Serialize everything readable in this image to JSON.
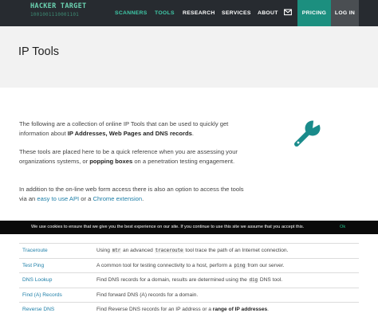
{
  "header": {
    "logo_text": "HACKER TARGET",
    "logo_sub": "1001001110001101",
    "nav": [
      "SCANNERS",
      "TOOLS",
      "RESEARCH",
      "SERVICES",
      "ABOUT"
    ],
    "mail_icon": "envelope-icon",
    "pricing_label": "PRICING",
    "login_label": "LOG IN",
    "colors": {
      "bar": "#272b30",
      "accent": "#3fc9a8",
      "pricing_bg": "#1c8f7f",
      "login_bg": "#4a4e52"
    }
  },
  "hero": {
    "title": "IP Tools"
  },
  "intro": {
    "p1_before": "The following are a collection of online IP Tools that can be used to quickly get information about ",
    "p1_bold": "IP Addresses, Web Pages and DNS records",
    "p1_after": ".",
    "p2_before": "These tools are placed here to be a quick reference when you are assessing your organizations systems, or ",
    "p2_bold": "popping boxes",
    "p2_after": " on a penetration testing engagement.",
    "p3_before": "In addition to the on-line web form access there is also an option to access the tools via an ",
    "p3_link1": "easy to use API",
    "p3_mid": " or a ",
    "p3_link2": "Chrome extension",
    "p3_after": ".",
    "icon": "wrench-icon"
  },
  "cookie": {
    "message": "We use cookies to ensure that we give you the best experience on our site. If you continue to use this site we assume that you accept this.",
    "ok_label": "Ok"
  },
  "tools": [
    {
      "name": "Traceroute",
      "d1": "Using ",
      "c1": "mtr",
      "d2": " an advanced ",
      "c2": "traceroute",
      "d3": " tool trace the path of an Internet connection."
    },
    {
      "name": "Test Ping",
      "d1": "A common tool for testing connectivity to a host, perform a ",
      "c1": "ping",
      "d2": " from our server."
    },
    {
      "name": "DNS Lookup",
      "d1": "Find DNS records for a domain, results are determined using the ",
      "c1": "dig",
      "d2": " DNS tool."
    },
    {
      "name": "Find (A) Records",
      "d1": "Find forward DNS (A) records for a domain."
    },
    {
      "name": "Reverse DNS",
      "d1": "Find Reverse DNS records for an IP address or a ",
      "b1": "range of IP addresses",
      "d2": "."
    }
  ]
}
